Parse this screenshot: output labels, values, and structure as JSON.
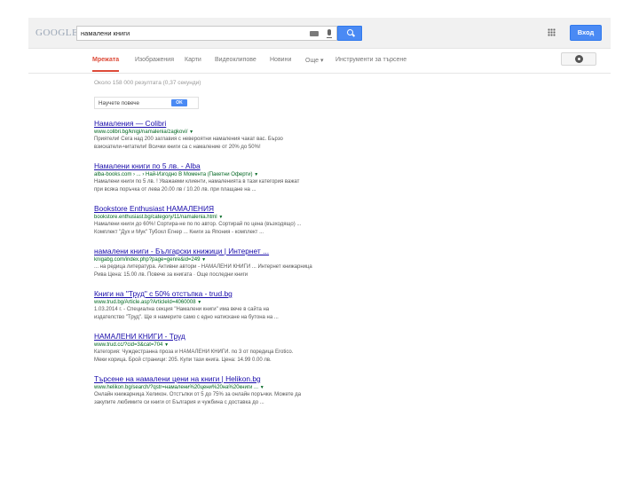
{
  "header": {
    "logo_text": "GOOGLE",
    "search_value": "намалени книги",
    "signin_label": "Вход"
  },
  "tabs": [
    {
      "label": "Мрежата"
    },
    {
      "label": "Изображения"
    },
    {
      "label": "Карти"
    },
    {
      "label": "Видеоклипове"
    },
    {
      "label": "Новини"
    },
    {
      "label": "Още ▾"
    },
    {
      "label": "Инструменти за търсене"
    }
  ],
  "stats": "Около 158 000 резултата (0,37 секунди)",
  "try_box": {
    "text": "Научете повече",
    "button": "OK"
  },
  "results": [
    {
      "title": "Намаления — Colibri",
      "url": "www.colibri.bg/knigi/namalenia/zagkovi/",
      "snippet1": "Приятели! Сега над 200 заглавия с невероятни намаления чакат вас. Бързо",
      "snippet2": "взискатели-читатели! Всички книги са с намаление от 20% до 50%!"
    },
    {
      "title": "Намалени книги по 5 лв. - Alba",
      "url": "alba-books.com › ... › Най-Изгодно В Момента (Пакетни Оферти)",
      "snippet1": "Намалени книги по 5 лв. ! Уважаеми клиенти, намаленията в тази категория важат",
      "snippet2": "при всяка поръчка от лева 20.00 лв / 10.20 лв. при плащане на ..."
    },
    {
      "title": "Bookstore Enthusiast НАМАЛЕНИЯ",
      "url": "bookstore.enthusiast.bg/category/11/namalenia.html",
      "snippet1": "Намалени книги до 60%! Сортира-не по по автор. Сортирай по цена (възходящо) ...",
      "snippet2": "Комплект \"Дух и Мук\" Тубохл Егнер ... Книги за Япония - комплект ..."
    },
    {
      "title": "намалени книги - Български книжици | Интернет ...",
      "url": "knigabg.com/index.php?page=genre&id=249",
      "snippet1": "... на редица литература. Активни автори - НАМАЛЕНИ КНИГИ ... Интернет книжарница",
      "snippet2": "Рива Цена: 15.00 лв. Повече за книгата · Още последни книги"
    },
    {
      "title": "Книги на \"Труд\" с 50% отстъпка - trud.bg",
      "url": "www.trud.bg/Article.asp?ArticleId=4060008",
      "snippet1": "1.03.2014 г. - Специална секция \"Намалени книги\" има вече в сайта на",
      "snippet2": "издателство \"Труд\". Ще я намерите само с едно натискане на бутона на ..."
    },
    {
      "title": "НАМАЛЕНИ КНИГИ - Труд",
      "url": "www.trud.cc/?cid=3&cat=704",
      "snippet1": "Категория: Чуждестранна проза и НАМАЛЕНИ КНИГИ. по 3 от поредица Erotico.",
      "snippet2": "Меки корица. Брой страници: 205. Купи тази книга. Цена: 14.99 0.00 лв."
    },
    {
      "title": "Търсене на намалени цени на книги | Helikon.bg",
      "url": "www.helikon.bg/search/?qstr=намалени%20цени%20на%20книги ...",
      "snippet1": "Онлайн книжарница Хеликон. Отстъпки от 5 до 75% за онлайн поръчки. Можете да",
      "snippet2": "закупите любимите си книги от България и чужбина с доставка до ..."
    }
  ]
}
